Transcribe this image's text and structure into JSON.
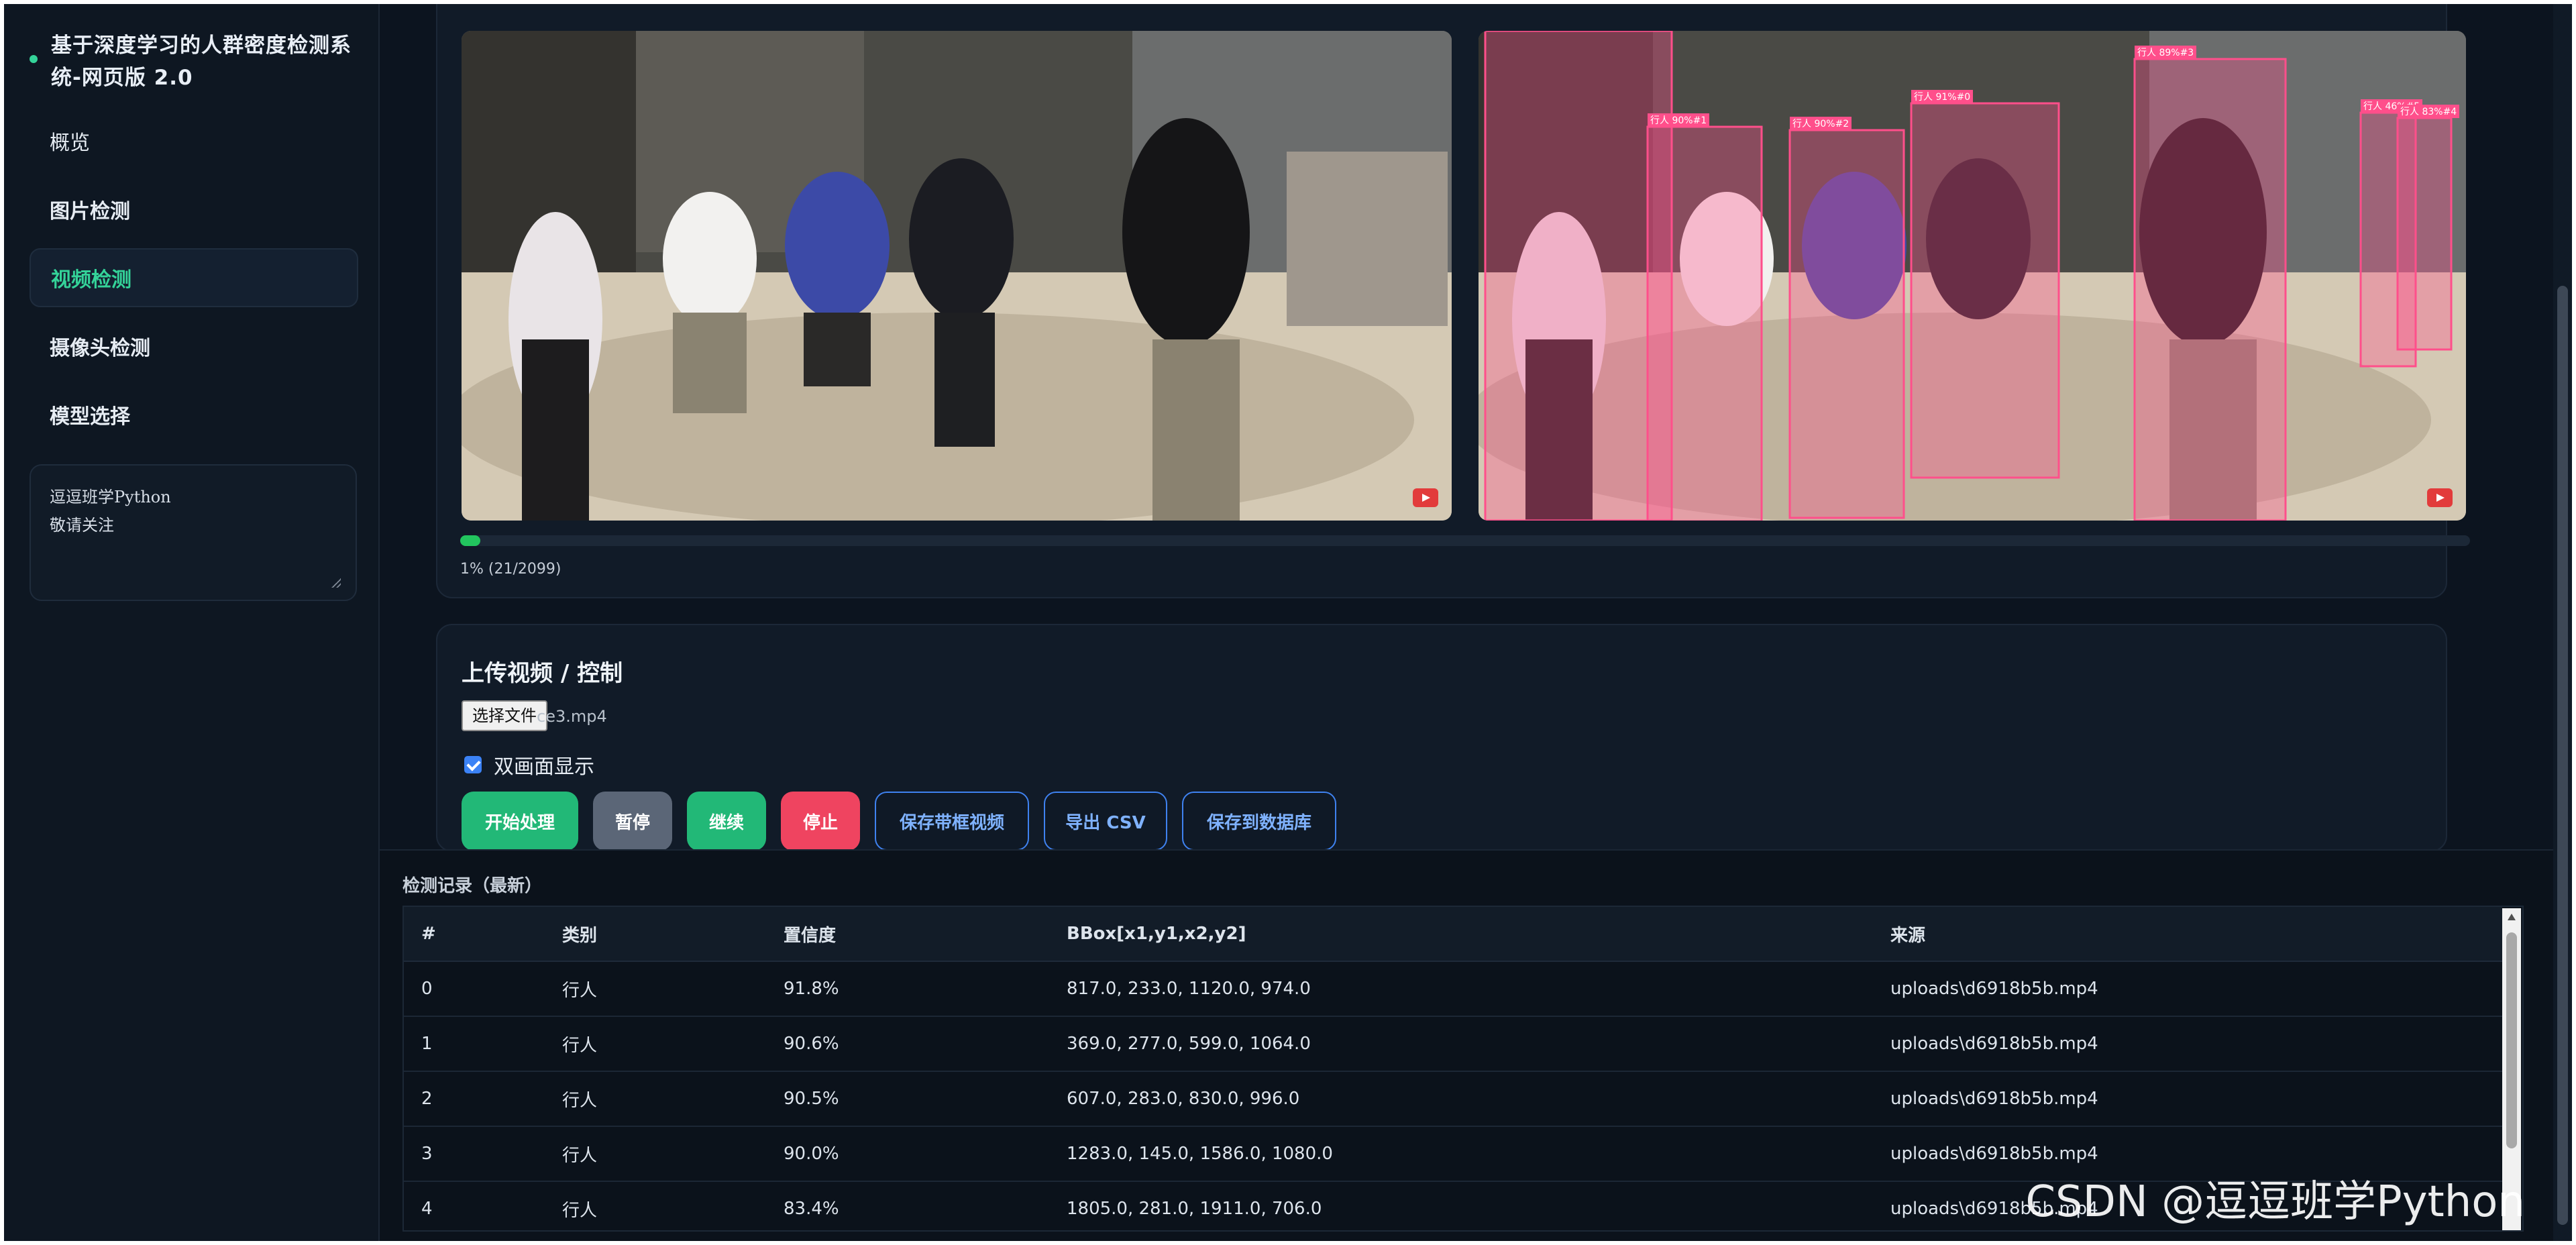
{
  "sidebar": {
    "brand_title": "基于深度学习的人群密度检测系统-网页版 2.0",
    "nav": [
      {
        "label": "概览"
      },
      {
        "label": "图片检测"
      },
      {
        "label": "视频检测"
      },
      {
        "label": "摄像头检测"
      },
      {
        "label": "模型选择"
      }
    ],
    "notes": [
      "逗逗班学Python",
      "敬请关注"
    ]
  },
  "video": {
    "progress_percent": 1,
    "progress_text": "1% (21/2099)",
    "box_labels": [
      "行人 90%#1",
      "行人 90%#2",
      "行人 91%#0",
      "行人 89%#3",
      "行人 46%#5",
      "行人 83%#4"
    ]
  },
  "controls": {
    "title": "上传视频 / 控制",
    "file_button": "选择文件",
    "file_name": "ce3.mp4",
    "dual_view_label": "双画面显示",
    "dual_view_checked": true,
    "buttons": {
      "start": "开始处理",
      "pause": "暂停",
      "resume": "继续",
      "stop": "停止",
      "save_video": "保存带框视频",
      "export_csv": "导出 CSV",
      "save_db": "保存到数据库"
    }
  },
  "records": {
    "title": "检测记录（最新）",
    "columns": [
      "#",
      "类别",
      "置信度",
      "BBox[x1,y1,x2,y2]",
      "来源"
    ],
    "rows": [
      [
        "0",
        "行人",
        "91.8%",
        "817.0, 233.0, 1120.0, 974.0",
        "uploads\\d6918b5b.mp4"
      ],
      [
        "1",
        "行人",
        "90.6%",
        "369.0, 277.0, 599.0, 1064.0",
        "uploads\\d6918b5b.mp4"
      ],
      [
        "2",
        "行人",
        "90.5%",
        "607.0, 283.0, 830.0, 996.0",
        "uploads\\d6918b5b.mp4"
      ],
      [
        "3",
        "行人",
        "90.0%",
        "1283.0, 145.0, 1586.0, 1080.0",
        "uploads\\d6918b5b.mp4"
      ],
      [
        "4",
        "行人",
        "83.4%",
        "1805.0, 281.0, 1911.0, 706.0",
        "uploads\\d6918b5b.mp4"
      ]
    ]
  },
  "watermark": "CSDN @逗逗班学Python",
  "colors": {
    "accent_green": "#22b877",
    "active_nav": "#34d399",
    "stop_red": "#ef4460",
    "outline_blue": "#3f82f0",
    "bbox_pink": "#ff4f8b"
  }
}
